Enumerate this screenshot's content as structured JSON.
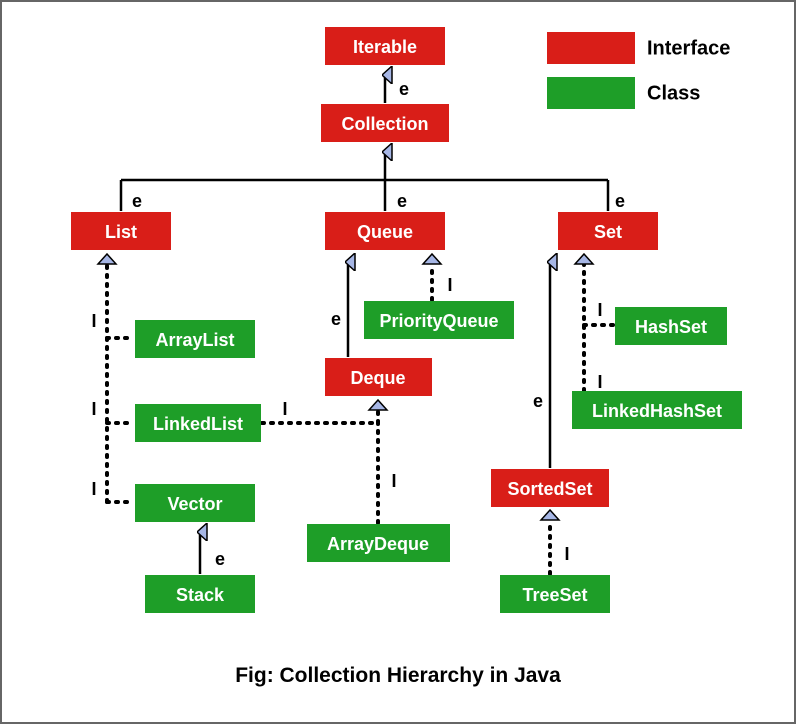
{
  "chart_data": {
    "type": "diagram",
    "title": "Collection Hierarchy in Java",
    "legend": [
      {
        "color": "#d91e18",
        "label": "Interface"
      },
      {
        "color": "#1e9e28",
        "label": "Class"
      }
    ],
    "nodes": [
      {
        "id": "iterable",
        "label": "Iterable",
        "kind": "interface"
      },
      {
        "id": "collection",
        "label": "Collection",
        "kind": "interface"
      },
      {
        "id": "list",
        "label": "List",
        "kind": "interface"
      },
      {
        "id": "queue",
        "label": "Queue",
        "kind": "interface"
      },
      {
        "id": "set",
        "label": "Set",
        "kind": "interface"
      },
      {
        "id": "deque",
        "label": "Deque",
        "kind": "interface"
      },
      {
        "id": "sortedset",
        "label": "SortedSet",
        "kind": "interface"
      },
      {
        "id": "arraylist",
        "label": "ArrayList",
        "kind": "class"
      },
      {
        "id": "linkedlist",
        "label": "LinkedList",
        "kind": "class"
      },
      {
        "id": "vector",
        "label": "Vector",
        "kind": "class"
      },
      {
        "id": "stack",
        "label": "Stack",
        "kind": "class"
      },
      {
        "id": "priorityqueue",
        "label": "PriorityQueue",
        "kind": "class"
      },
      {
        "id": "arraydeque",
        "label": "ArrayDeque",
        "kind": "class"
      },
      {
        "id": "hashset",
        "label": "HashSet",
        "kind": "class"
      },
      {
        "id": "linkedhashset",
        "label": "LinkedHashSet",
        "kind": "class"
      },
      {
        "id": "treeset",
        "label": "TreeSet",
        "kind": "class"
      }
    ],
    "edges": [
      {
        "from": "collection",
        "to": "iterable",
        "type": "e"
      },
      {
        "from": "list",
        "to": "collection",
        "type": "e"
      },
      {
        "from": "queue",
        "to": "collection",
        "type": "e"
      },
      {
        "from": "set",
        "to": "collection",
        "type": "e"
      },
      {
        "from": "deque",
        "to": "queue",
        "type": "e"
      },
      {
        "from": "sortedset",
        "to": "set",
        "type": "e"
      },
      {
        "from": "stack",
        "to": "vector",
        "type": "e"
      },
      {
        "from": "arraylist",
        "to": "list",
        "type": "I"
      },
      {
        "from": "linkedlist",
        "to": "list",
        "type": "I"
      },
      {
        "from": "vector",
        "to": "list",
        "type": "I"
      },
      {
        "from": "priorityqueue",
        "to": "queue",
        "type": "I"
      },
      {
        "from": "linkedlist",
        "to": "deque",
        "type": "I"
      },
      {
        "from": "arraydeque",
        "to": "deque",
        "type": "I"
      },
      {
        "from": "hashset",
        "to": "set",
        "type": "I"
      },
      {
        "from": "linkedhashset",
        "to": "set",
        "type": "I"
      },
      {
        "from": "treeset",
        "to": "sortedset",
        "type": "I"
      }
    ]
  },
  "labels": {
    "iterable": "Iterable",
    "collection": "Collection",
    "list": "List",
    "queue": "Queue",
    "set": "Set",
    "deque": "Deque",
    "sortedset": "SortedSet",
    "arraylist": "ArrayList",
    "linkedlist": "LinkedList",
    "vector": "Vector",
    "stack": "Stack",
    "priorityqueue": "PriorityQueue",
    "arraydeque": "ArrayDeque",
    "hashset": "HashSet",
    "linkedhashset": "LinkedHashSet",
    "treeset": "TreeSet",
    "e": "e",
    "I": "I",
    "interface": "Interface",
    "class": "Class",
    "caption": "Fig:  Collection Hierarchy in Java"
  },
  "colors": {
    "interface": "#d91e18",
    "class": "#1e9e28",
    "arrowFill": "#a6b6e5",
    "arrowStroke": "#000"
  }
}
